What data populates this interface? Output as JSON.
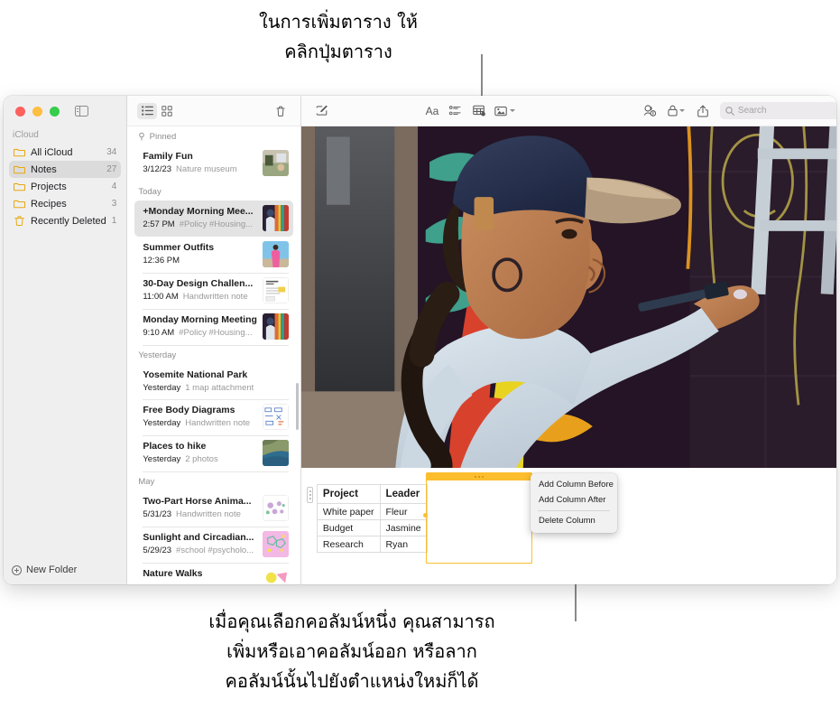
{
  "callouts": {
    "top": "ในการเพิ่มตาราง ให้\nคลิกปุ่มตาราง",
    "bottom": "เมื่อคุณเลือกคอลัมน์หนึ่ง คุณสามารถ\nเพิ่มหรือเอาคอลัมน์ออก หรือลาก\nคอลัมน์นั้นไปยังตำแหน่งใหม่ก็ได้"
  },
  "window": {
    "traffic_lights": [
      "close",
      "minimize",
      "zoom"
    ]
  },
  "sidebar": {
    "section_title": "iCloud",
    "items": [
      {
        "label": "All iCloud",
        "count": "34",
        "icon": "folder-icon",
        "selected": false
      },
      {
        "label": "Notes",
        "count": "27",
        "icon": "folder-icon",
        "selected": true
      },
      {
        "label": "Projects",
        "count": "4",
        "icon": "folder-icon",
        "selected": false
      },
      {
        "label": "Recipes",
        "count": "3",
        "icon": "folder-icon",
        "selected": false
      },
      {
        "label": "Recently Deleted",
        "count": "1",
        "icon": "trash-icon",
        "selected": false
      }
    ],
    "new_folder_label": "New Folder"
  },
  "notes_toolbar": {
    "list_view": "list-view-icon",
    "gallery_view": "gallery-view-icon",
    "delete": "trash-icon"
  },
  "notes_list": {
    "groups": [
      {
        "label": "Pinned",
        "pinned": true,
        "notes": [
          {
            "title": "Family Fun",
            "time": "3/12/23",
            "meta": "Nature museum",
            "thumb": "photo-museum"
          }
        ]
      },
      {
        "label": "Today",
        "pinned": false,
        "notes": [
          {
            "title": "+Monday Morning Mee...",
            "time": "2:57 PM",
            "meta": "#Policy #Housing...",
            "thumb": "photo-mural",
            "selected": true
          },
          {
            "title": "Summer Outfits",
            "time": "12:36 PM",
            "meta": "",
            "thumb": "photo-outfit"
          },
          {
            "title": "30-Day Design Challen...",
            "time": "11:00 AM",
            "meta": "Handwritten note",
            "thumb": "doc-sketch"
          },
          {
            "title": "Monday Morning Meeting",
            "time": "9:10 AM",
            "meta": "#Policy #Housing...",
            "thumb": "photo-mural"
          }
        ]
      },
      {
        "label": "Yesterday",
        "pinned": false,
        "notes": [
          {
            "title": "Yosemite National Park",
            "time": "Yesterday",
            "meta": "1 map attachment",
            "thumb": "none"
          },
          {
            "title": "Free Body Diagrams",
            "time": "Yesterday",
            "meta": "Handwritten note",
            "thumb": "doc-diagram"
          },
          {
            "title": "Places to hike",
            "time": "Yesterday",
            "meta": "2 photos",
            "thumb": "photo-coast"
          }
        ]
      },
      {
        "label": "May",
        "pinned": false,
        "notes": [
          {
            "title": "Two-Part Horse Anima...",
            "time": "5/31/23",
            "meta": "Handwritten note",
            "thumb": "doc-horse"
          },
          {
            "title": "Sunlight and Circadian...",
            "time": "5/29/23",
            "meta": "#school #psycholo...",
            "thumb": "photo-pink"
          },
          {
            "title": "Nature Walks",
            "time": "",
            "meta": "",
            "thumb": "photo-leaf"
          }
        ]
      }
    ]
  },
  "editor_toolbar": {
    "compose": "compose-icon",
    "format": "Aa",
    "checklist": "checklist-icon",
    "table": "table-icon",
    "media": "media-icon",
    "collaborate": "collaborate-icon",
    "lock": "lock-icon",
    "share": "share-icon",
    "search_placeholder": "Search",
    "search_value": ""
  },
  "note_table": {
    "headers": [
      "Project",
      "Leader"
    ],
    "rows": [
      [
        "White paper",
        "Fleur"
      ],
      [
        "Budget",
        "Jasmine"
      ],
      [
        "Research",
        "Ryan"
      ]
    ],
    "selected_column_index": 1,
    "selection_color": "#fcbe2d"
  },
  "context_menu": {
    "items": [
      {
        "label": "Add Column Before",
        "separator_after": false
      },
      {
        "label": "Add Column After",
        "separator_after": true
      },
      {
        "label": "Delete Column",
        "separator_after": false
      }
    ]
  }
}
